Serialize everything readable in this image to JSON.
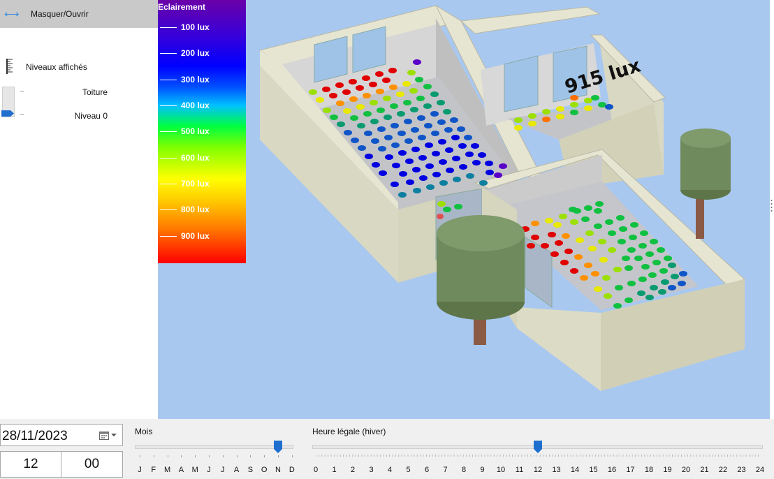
{
  "panel": {
    "toggle_label": "Masquer/Ouvrir",
    "levels_title": "Niveaux affichés",
    "levels": [
      {
        "label": "Toiture",
        "selected": false
      },
      {
        "label": "Niveau 0",
        "selected": true
      }
    ]
  },
  "legend": {
    "title": "Eclairement",
    "entries": [
      "100 lux",
      "200 lux",
      "300 lux",
      "400 lux",
      "500 lux",
      "600 lux",
      "700 lux",
      "800 lux",
      "900 lux"
    ]
  },
  "scene": {
    "annotation": "915 lux"
  },
  "date": {
    "value": "28/11/2023",
    "hour": "12",
    "minute": "00"
  },
  "month_slider": {
    "title": "Mois",
    "ticks": [
      "J",
      "F",
      "M",
      "A",
      "M",
      "J",
      "J",
      "A",
      "S",
      "O",
      "N",
      "D"
    ],
    "selected_index": 10
  },
  "hour_slider": {
    "title": "Heure légale (hiver)",
    "ticks": [
      "0",
      "1",
      "2",
      "3",
      "4",
      "5",
      "6",
      "7",
      "8",
      "9",
      "10",
      "11",
      "12",
      "13",
      "14",
      "15",
      "16",
      "17",
      "18",
      "19",
      "20",
      "21",
      "22",
      "23",
      "24"
    ],
    "selected_value": 12
  },
  "colors": {
    "accent": "#1f6fcf",
    "sky": "#a8c8f0",
    "wall": "#d9d8c2",
    "tree_foliage": "#6f8a5c",
    "trunk": "#8b5a45"
  }
}
